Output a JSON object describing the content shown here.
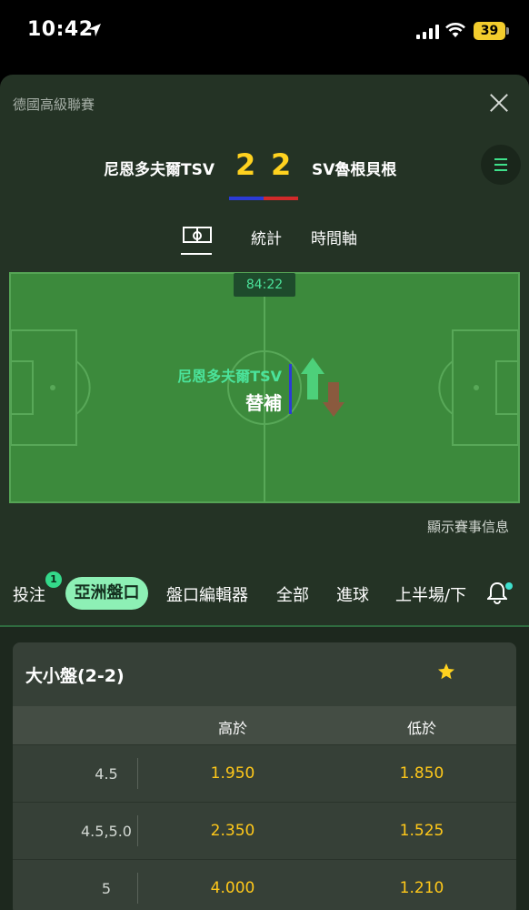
{
  "status_bar": {
    "time": "10:42",
    "battery": "39"
  },
  "header": {
    "league": "德國高級聯賽",
    "home_team": "尼恩多夫爾TSV",
    "away_team": "SV魯根貝根",
    "home_score": "2",
    "away_score": "2"
  },
  "view_tabs": {
    "stats": "統計",
    "timeline": "時間軸"
  },
  "pitch": {
    "clock": "84:22",
    "event_team": "尼恩多夫爾TSV",
    "event_type": "替補"
  },
  "show_info": "顯示賽事信息",
  "market_tabs": {
    "bets": "投注",
    "bets_badge": "1",
    "asian": "亞洲盤口",
    "editor": "盤口編輯器",
    "all": "全部",
    "goals": "進球",
    "half": "上半場/下"
  },
  "odds_card": {
    "title": "大小盤(2-2)",
    "col_over": "高於",
    "col_under": "低於",
    "rows": [
      {
        "line": "4.5",
        "over": "1.950",
        "under": "1.850"
      },
      {
        "line": "4.5,5.0",
        "over": "2.350",
        "under": "1.525"
      },
      {
        "line": "5",
        "over": "4.000",
        "under": "1.210"
      }
    ]
  },
  "colors": {
    "accent_green": "#4be39b",
    "odds_yellow": "#ffc81a",
    "score_yellow": "#ffd21f",
    "home_kit": "#2b3bd6",
    "away_kit": "#d12a2a"
  }
}
